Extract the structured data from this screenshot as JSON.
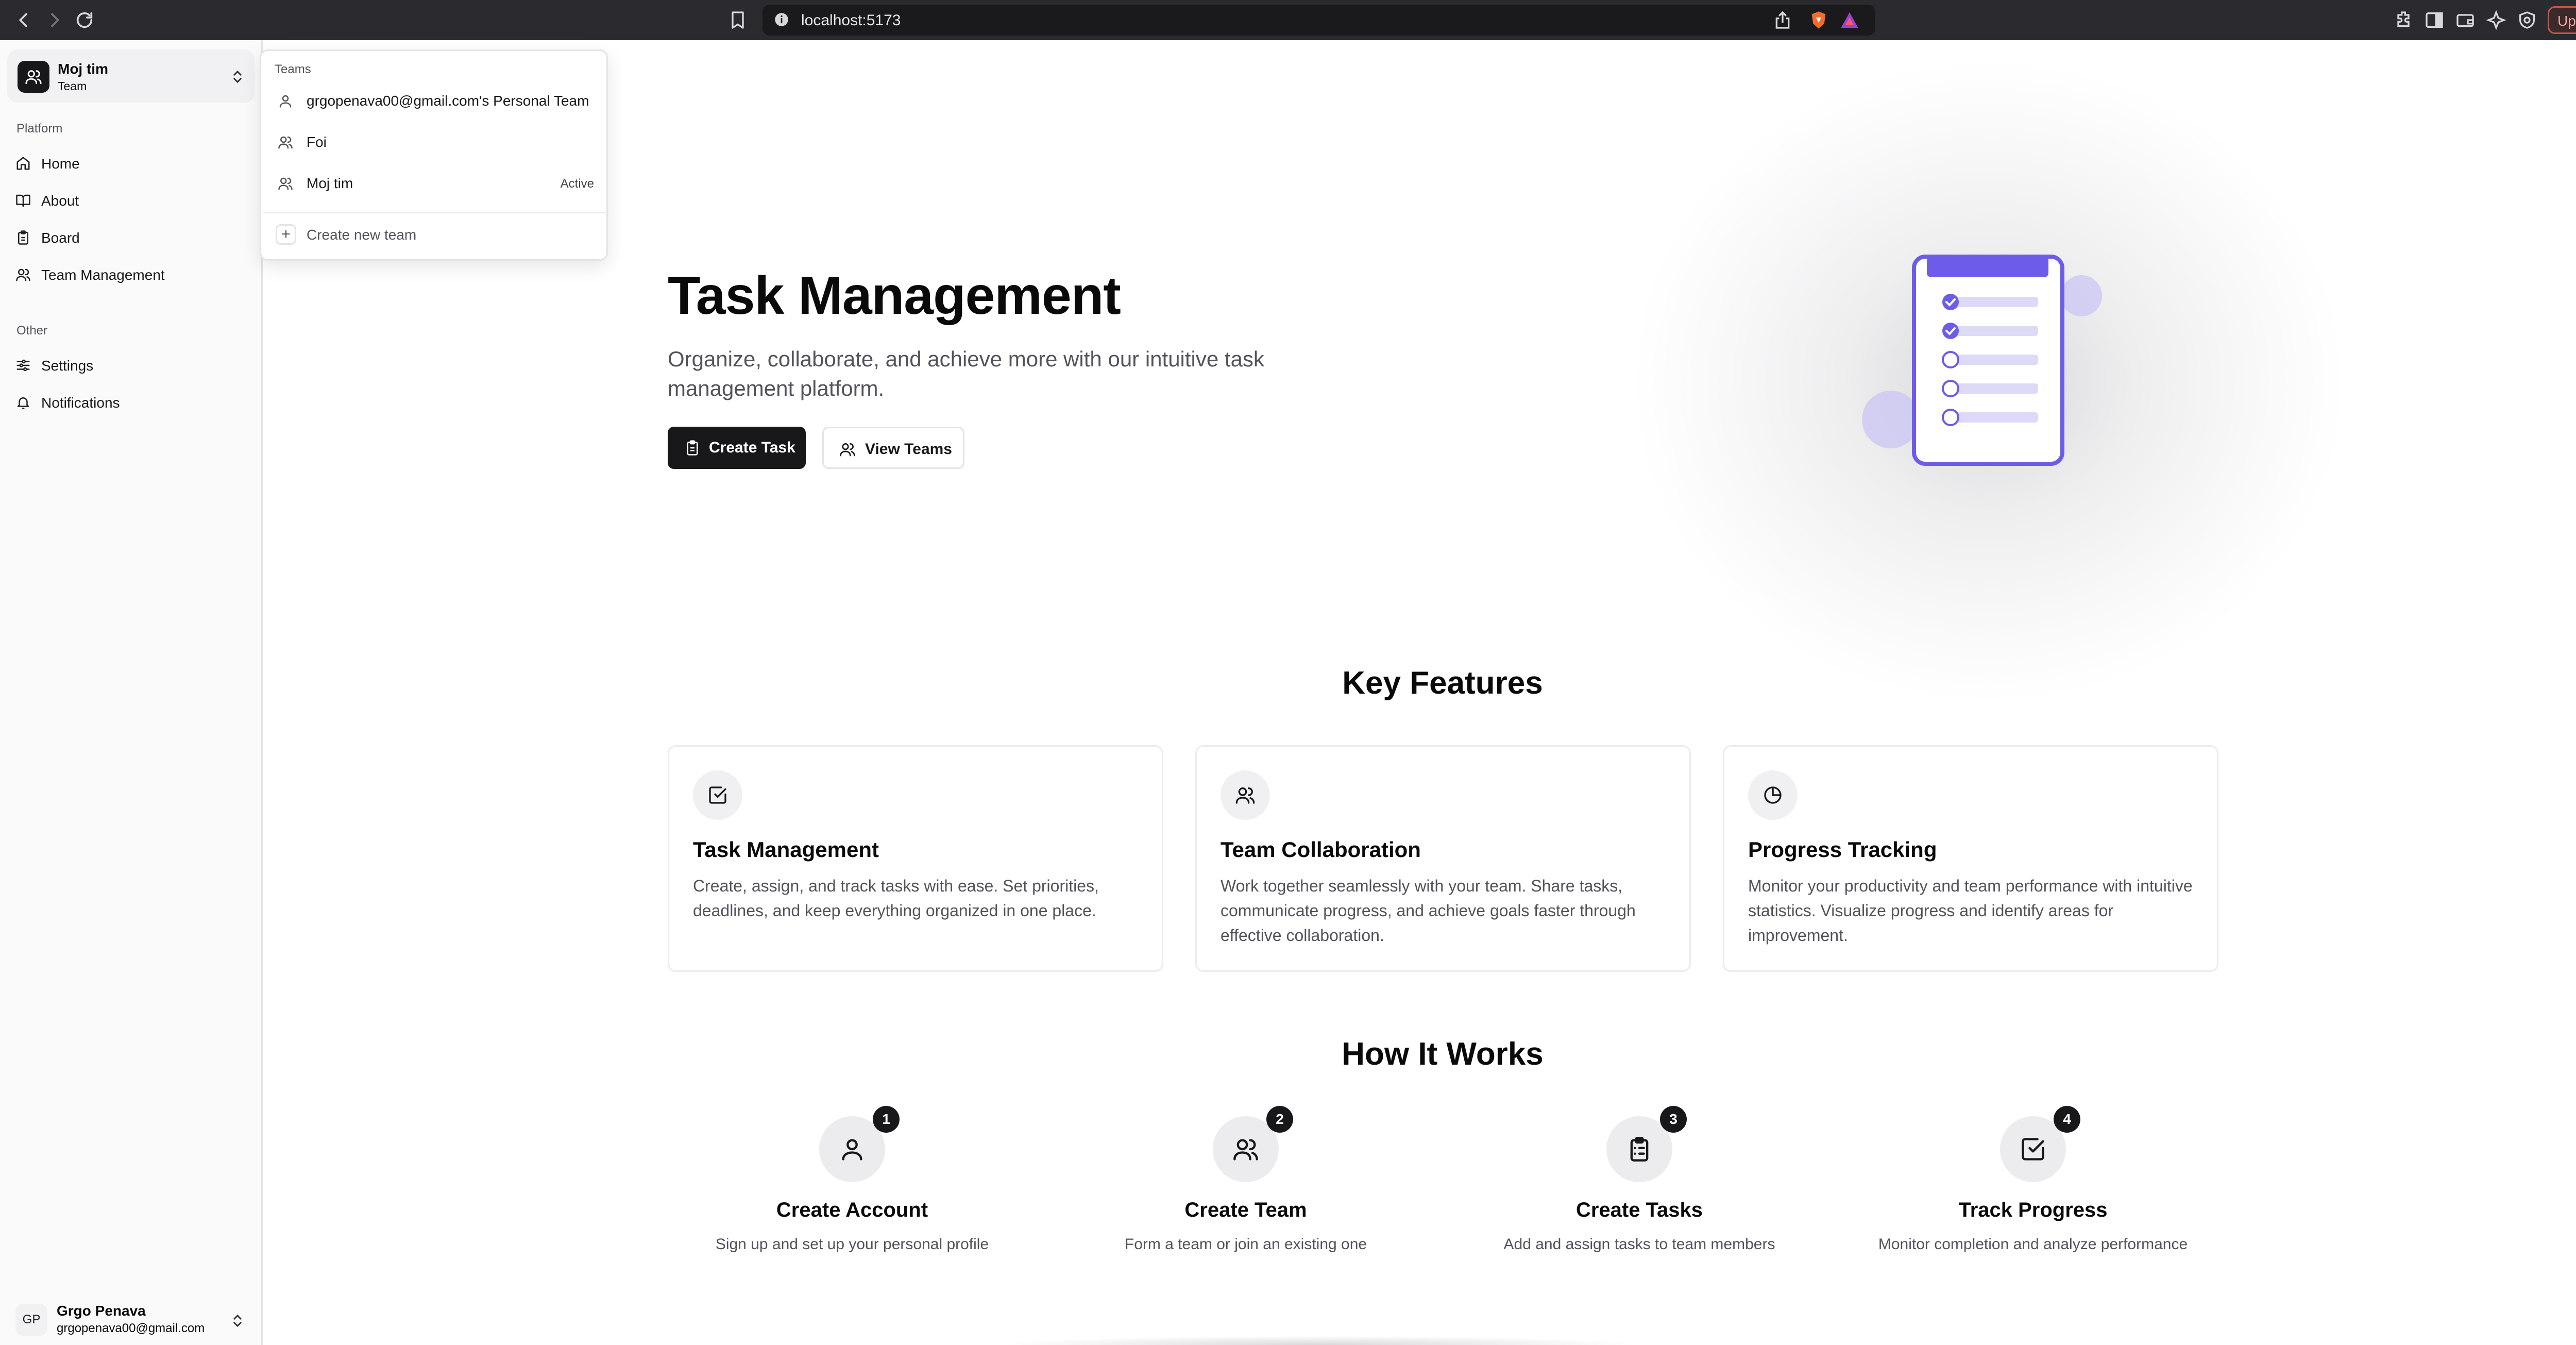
{
  "browser": {
    "url": "localhost:5173",
    "update_label": "Update"
  },
  "sidebar": {
    "team": {
      "name": "Moj tim",
      "plan": "Team"
    },
    "platform_label": "Platform",
    "platform_items": [
      {
        "label": "Home",
        "icon": "home-icon"
      },
      {
        "label": "About",
        "icon": "book-open-icon"
      },
      {
        "label": "Board",
        "icon": "clipboard-icon"
      },
      {
        "label": "Team Management",
        "icon": "users-icon"
      }
    ],
    "other_label": "Other",
    "other_items": [
      {
        "label": "Settings",
        "icon": "sliders-icon"
      },
      {
        "label": "Notifications",
        "icon": "bell-icon"
      }
    ],
    "user": {
      "initials": "GP",
      "name": "Grgo Penava",
      "email": "grgopenava00@gmail.com"
    }
  },
  "team_dropdown": {
    "label": "Teams",
    "teams": [
      {
        "label": "grgopenava00@gmail.com's Personal Team",
        "icon": "user-icon",
        "badge": ""
      },
      {
        "label": "Foi",
        "icon": "users-icon",
        "badge": ""
      },
      {
        "label": "Moj tim",
        "icon": "users-icon",
        "badge": "Active"
      }
    ],
    "create_label": "Create new team"
  },
  "hero": {
    "title": "Task Management",
    "description": "Organize, collaborate, and achieve more with our intuitive task management platform.",
    "create_button": "Create Task",
    "teams_button": "View Teams",
    "illustration_colors": {
      "accent": "#6d5ce7",
      "light": "#dcdaf7",
      "bubble": "#c9c6f4"
    }
  },
  "features": {
    "title": "Key Features",
    "items": [
      {
        "title": "Task Management",
        "desc": "Create, assign, and track tasks with ease. Set priorities, deadlines, and keep everything organized in one place.",
        "icon": "check-square-icon"
      },
      {
        "title": "Team Collaboration",
        "desc": "Work together seamlessly with your team. Share tasks, communicate progress, and achieve goals faster through effective collaboration.",
        "icon": "users-icon"
      },
      {
        "title": "Progress Tracking",
        "desc": "Monitor your productivity and team performance with intuitive statistics. Visualize progress and identify areas for improvement.",
        "icon": "pie-chart-icon"
      }
    ]
  },
  "how": {
    "title": "How It Works",
    "steps": [
      {
        "num": "1",
        "title": "Create Account",
        "desc": "Sign up and set up your personal profile",
        "icon": "user-icon"
      },
      {
        "num": "2",
        "title": "Create Team",
        "desc": "Form a team or join an existing one",
        "icon": "users-icon"
      },
      {
        "num": "3",
        "title": "Create Tasks",
        "desc": "Add and assign tasks to team members",
        "icon": "clipboard-list-icon"
      },
      {
        "num": "4",
        "title": "Track Progress",
        "desc": "Monitor completion and analyze performance",
        "icon": "check-square-icon"
      }
    ]
  }
}
